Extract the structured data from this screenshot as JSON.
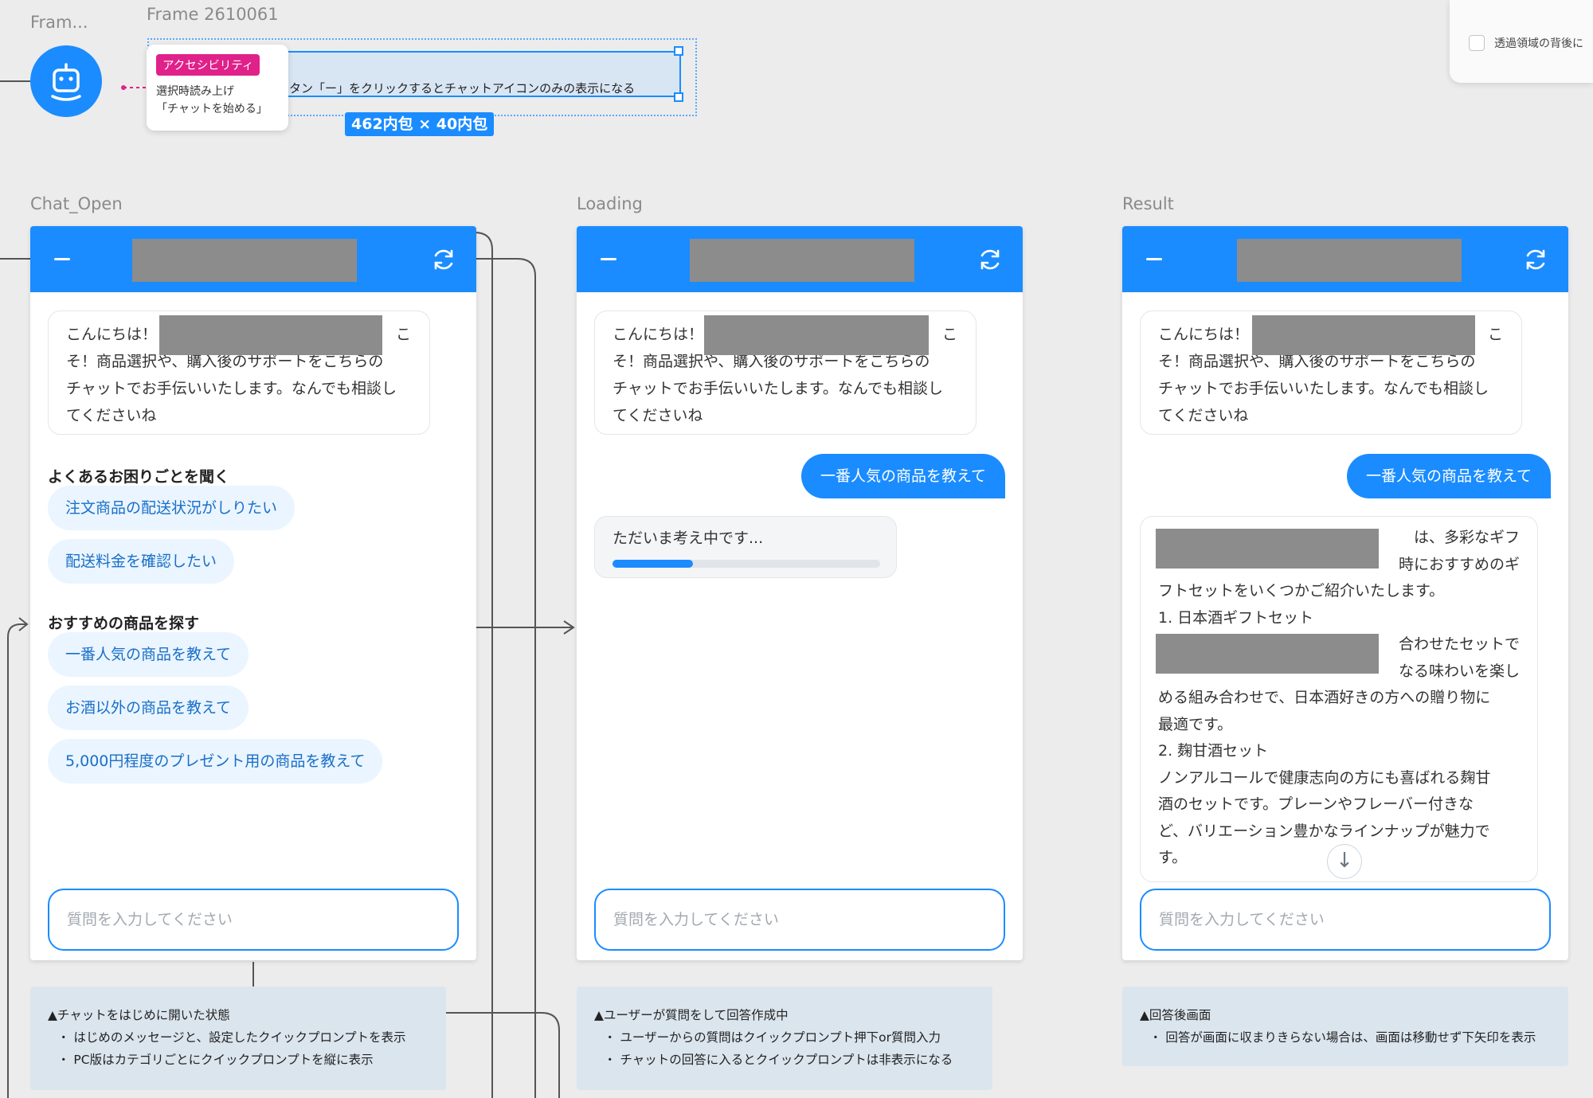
{
  "top": {
    "frame_small_label": "Fram...",
    "frame_label": "Frame 2610061",
    "tooltip_tag": "アクセシビリティ",
    "tooltip_line1": "選択時読み上げ",
    "tooltip_line2": "「チャットを始める」",
    "selection_text": "タン「ー」をクリックするとチャットアイコンのみの表示になる",
    "dimension_badge": "462内包 × 40内包",
    "corner_checkbox_label": "透過領域の背後に"
  },
  "frames": {
    "chat_open": "Chat_Open",
    "loading": "Loading",
    "result": "Result"
  },
  "welcome": {
    "line1": "こんにちは！",
    "line1_tail": "こ",
    "line2": "そ！商品選択や、購入後のサポートをこちらの",
    "line3": "チャットでお手伝いいたします。なんでも相談し",
    "line4": "てくださいね"
  },
  "chat_open": {
    "section1": "よくあるお困りごとを聞く",
    "chips1": [
      "注文商品の配送状況がしりたい",
      "配送料金を確認したい"
    ],
    "section2": "おすすめの商品を探す",
    "chips2": [
      "一番人気の商品を教えて",
      "お酒以外の商品を教えて",
      "5,000円程度のプレゼント用の商品を教えて"
    ]
  },
  "input_placeholder": "質問を入力してください",
  "user_message": "一番人気の商品を教えて",
  "loading": {
    "text": "ただいま考え中です...",
    "progress": 0.3
  },
  "result": {
    "line1_tail": "は、多彩なギフ",
    "line2_tail": "時におすすめのギ",
    "line3": "フトセットをいくつかご紹介いたします。",
    "line4": "1. 日本酒ギフトセット",
    "line5_tail": "合わせたセットで",
    "line6_tail": "なる味わいを楽し",
    "line7": "める組み合わせで、日本酒好きの方への贈り物に",
    "line8": "最適です。",
    "line9": "2. 麹甘酒セット",
    "line10": "ノンアルコールで健康志向の方にも喜ばれる麹甘",
    "line11": "酒のセットです。プレーンやフレーバー付きな",
    "line12": "ど、バリエーション豊かなラインナップが魅力で",
    "line13": "す。",
    "scroll_down_glyph": "↓"
  },
  "notes": {
    "chat_open": {
      "title": "▲チャットをはじめに開いた状態",
      "items": [
        "・ はじめのメッセージと、設定したクイックプロンプトを表示",
        "・ PC版はカテゴリごとにクイックプロンプトを縦に表示"
      ]
    },
    "loading": {
      "title": "▲ユーザーが質問をして回答作成中",
      "items": [
        "・ ユーザーからの質問はクイックプロンプト押下or質問入力",
        "・ チャットの回答に入るとクイックプロンプトは非表示になる"
      ]
    },
    "result": {
      "title": "▲回答後画面",
      "items": [
        "・ 回答が画面に収まりきらない場合は、画面は移動せず下矢印を表示"
      ]
    }
  },
  "icons": {
    "minimize": "minimize-icon",
    "refresh": "refresh-icon",
    "robot": "robot-icon",
    "arrow_down": "arrow-down-icon"
  },
  "colors": {
    "accent": "#1a8cff",
    "chip_bg": "#eaf5ff",
    "chip_text": "#1a6fc8",
    "tag": "#e0218a",
    "redaction": "#8c8c8c",
    "note_bg": "#dbe5ee"
  }
}
